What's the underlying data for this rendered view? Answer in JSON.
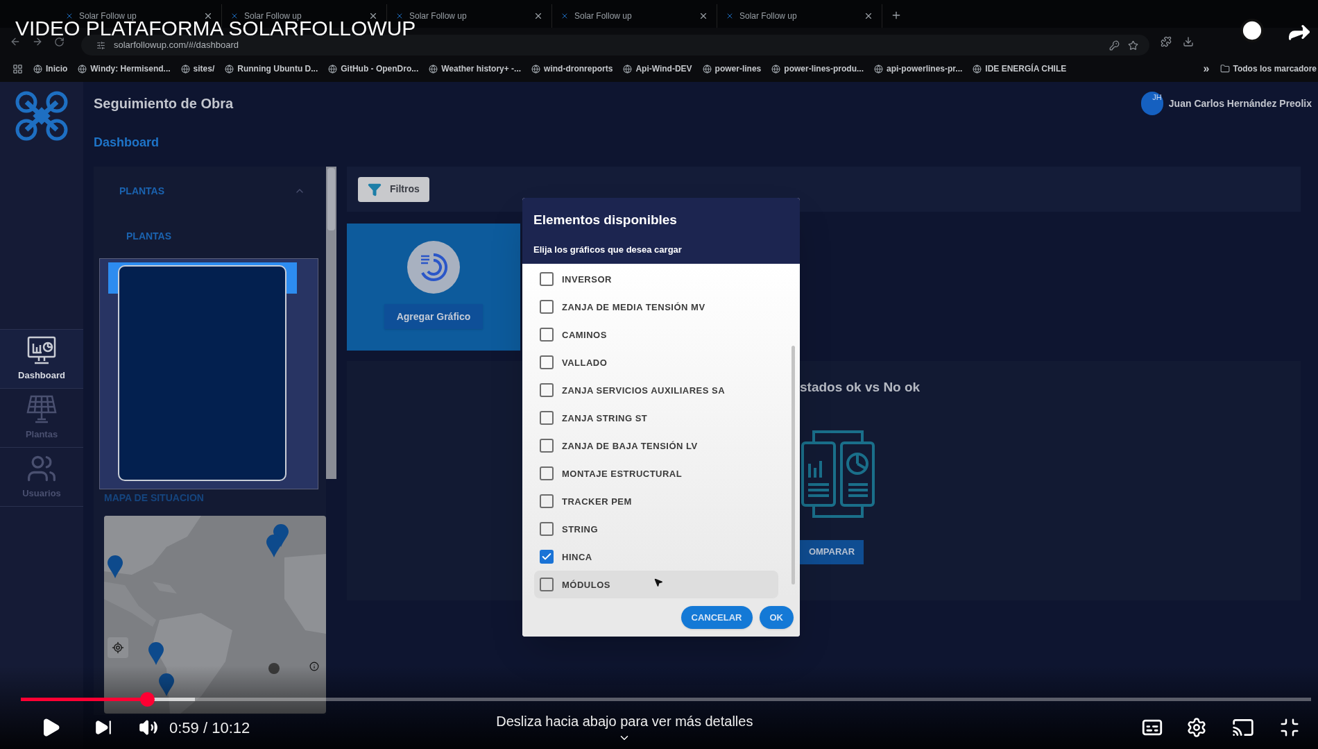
{
  "video": {
    "title": "VIDEO PLATAFORMA SOLARFOLLOWUP",
    "time": "0:59 / 10:12",
    "hint": "Desliza hacia abajo para ver más detalles",
    "progress": {
      "level": 0.098
    },
    "buffered": {
      "level": 0.135
    }
  },
  "browser": {
    "tabs": [
      {
        "label": "Solar Follow up"
      },
      {
        "label": "Solar Follow up"
      },
      {
        "label": "Solar Follow up"
      },
      {
        "label": "Solar Follow up"
      },
      {
        "label": "Solar Follow up"
      }
    ],
    "address": "solarfollowup.com/#/dashboard",
    "bookmarks": [
      {
        "label": "Inicio"
      },
      {
        "label": "Windy: Hermisend..."
      },
      {
        "label": "sites/"
      },
      {
        "label": "Running Ubuntu D..."
      },
      {
        "label": "GitHub - OpenDro..."
      },
      {
        "label": "Weather history+ -..."
      },
      {
        "label": "wind-dronreports"
      },
      {
        "label": "Api-Wind-DEV"
      },
      {
        "label": "power-lines"
      },
      {
        "label": "power-lines-produ..."
      },
      {
        "label": "api-powerlines-pr..."
      },
      {
        "label": "IDE ENERGÍA CHILE"
      }
    ],
    "more": "»",
    "all_bookmarks": "Todos los marcadore"
  },
  "app": {
    "header_title": "Seguimiento de Obra",
    "user": {
      "initials": "JH",
      "name": "Juan Carlos Hernández Preolix"
    },
    "page_title": "Dashboard",
    "nav": [
      {
        "label": "Dashboard",
        "kind": "dashboard",
        "selected": true
      },
      {
        "label": "Plantas",
        "kind": "plants",
        "selected": false
      },
      {
        "label": "Usuarios",
        "kind": "users",
        "selected": false
      }
    ],
    "plants_panel": {
      "title": "PLANTAS",
      "expanded": true,
      "subtitle": "PLANTAS",
      "map_title": "MAPA DE SITUACION"
    },
    "filters_button": "Filtros",
    "add_chart": "Agregar Gráfico",
    "status_card": {
      "title": "stados ok vs No ok",
      "button": "OMPARAR"
    },
    "dialog": {
      "title": "Elementos disponibles",
      "subtitle": "Elija los gráficos que desea cargar",
      "items": [
        {
          "label": "INVERSOR",
          "checked": false,
          "hovered": false
        },
        {
          "label": "ZANJA DE MEDIA TENSIÓN MV",
          "checked": false,
          "hovered": false
        },
        {
          "label": "CAMINOS",
          "checked": false,
          "hovered": false
        },
        {
          "label": "VALLADO",
          "checked": false,
          "hovered": false
        },
        {
          "label": "ZANJA SERVICIOS AUXILIARES SA",
          "checked": false,
          "hovered": false
        },
        {
          "label": "ZANJA STRING ST",
          "checked": false,
          "hovered": false
        },
        {
          "label": "ZANJA DE BAJA TENSIÓN LV",
          "checked": false,
          "hovered": false
        },
        {
          "label": "MONTAJE ESTRUCTURAL",
          "checked": false,
          "hovered": false
        },
        {
          "label": "TRACKER PEM",
          "checked": false,
          "hovered": false
        },
        {
          "label": "STRING",
          "checked": false,
          "hovered": false
        },
        {
          "label": "HINCA",
          "checked": true,
          "hovered": false
        },
        {
          "label": "MÓDULOS",
          "checked": false,
          "hovered": true
        }
      ],
      "buttons": [
        {
          "label": "CANCELAR"
        },
        {
          "label": "OK"
        }
      ]
    }
  }
}
